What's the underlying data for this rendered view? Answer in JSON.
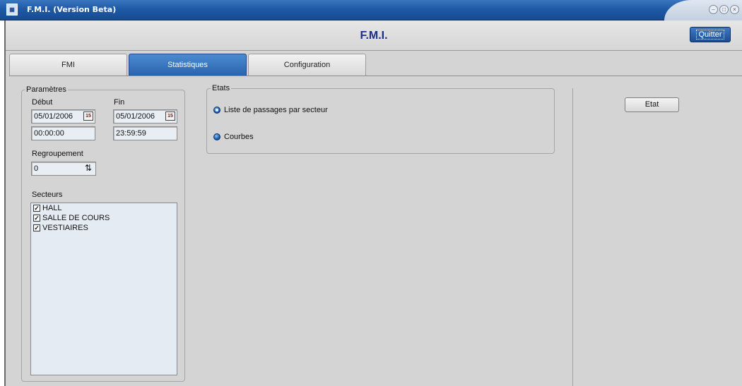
{
  "window": {
    "title": "F.M.I. (Version Beta)",
    "icon": "fmi-app-icon"
  },
  "header": {
    "title": "F.M.I.",
    "quit_label": "Quitter"
  },
  "tabs": [
    {
      "label": "FMI",
      "active": false
    },
    {
      "label": "Statistiques",
      "active": true
    },
    {
      "label": "Configuration",
      "active": false
    }
  ],
  "parametres": {
    "legend": "Paramètres",
    "debut_label": "Début",
    "fin_label": "Fin",
    "debut_date": "05/01/2006",
    "debut_time": "00:00:00",
    "fin_date": "05/01/2006",
    "fin_time": "23:59:59",
    "calendar_glyph": "15",
    "regroupement_label": "Regroupement",
    "regroupement_value": "0",
    "secteurs_label": "Secteurs",
    "secteurs": [
      {
        "label": "HALL",
        "checked": true
      },
      {
        "label": "SALLE DE COURS",
        "checked": true
      },
      {
        "label": "VESTIAIRES",
        "checked": true
      }
    ]
  },
  "etats": {
    "legend": "Etats",
    "options": [
      {
        "label": "Liste de passages par secteur",
        "selected": true
      },
      {
        "label": "Courbes",
        "selected": false
      }
    ]
  },
  "actions": {
    "etat_label": "Etat"
  },
  "colors": {
    "accent": "#2a63ac",
    "heading": "#1b2f8a",
    "panel": "#d4d4d4"
  }
}
